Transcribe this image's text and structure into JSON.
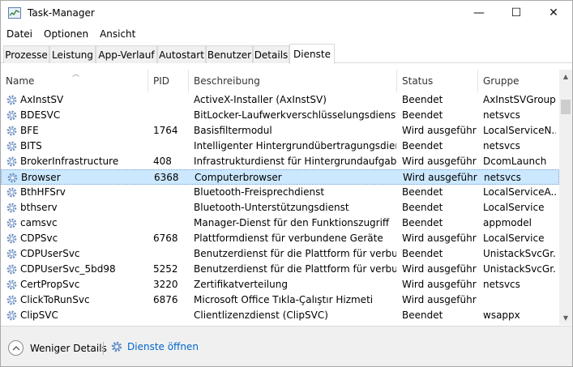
{
  "window": {
    "title": "Task-Manager",
    "minimize": "—",
    "maximize": "☐",
    "close": "✕"
  },
  "menu": [
    "Datei",
    "Optionen",
    "Ansicht"
  ],
  "tabs": [
    {
      "label": "Prozesse",
      "active": false
    },
    {
      "label": "Leistung",
      "active": false
    },
    {
      "label": "App-Verlauf",
      "active": false
    },
    {
      "label": "Autostart",
      "active": false
    },
    {
      "label": "Benutzer",
      "active": false
    },
    {
      "label": "Details",
      "active": false
    },
    {
      "label": "Dienste",
      "active": true
    }
  ],
  "columns": {
    "name": "Name",
    "pid": "PID",
    "desc": "Beschreibung",
    "status": "Status",
    "group": "Gruppe"
  },
  "rows": [
    {
      "name": "AxInstSV",
      "pid": "",
      "desc": "ActiveX-Installer (AxInstSV)",
      "status": "Beendet",
      "group": "AxInstSVGroup"
    },
    {
      "name": "BDESVC",
      "pid": "",
      "desc": "BitLocker-Laufwerkverschlüsselungsdienst",
      "status": "Beendet",
      "group": "netsvcs"
    },
    {
      "name": "BFE",
      "pid": "1764",
      "desc": "Basisfiltermodul",
      "status": "Wird ausgeführt",
      "group": "LocalServiceN..."
    },
    {
      "name": "BITS",
      "pid": "",
      "desc": "Intelligenter Hintergrundübertragungsdienst",
      "status": "Beendet",
      "group": "netsvcs"
    },
    {
      "name": "BrokerInfrastructure",
      "pid": "408",
      "desc": "Infrastrukturdienst für Hintergrundaufgaben",
      "status": "Wird ausgeführt",
      "group": "DcomLaunch"
    },
    {
      "name": "Browser",
      "pid": "6368",
      "desc": "Computerbrowser",
      "status": "Wird ausgeführt",
      "group": "netsvcs",
      "selected": true
    },
    {
      "name": "BthHFSrv",
      "pid": "",
      "desc": "Bluetooth-Freisprechdienst",
      "status": "Beendet",
      "group": "LocalServiceA..."
    },
    {
      "name": "bthserv",
      "pid": "",
      "desc": "Bluetooth-Unterstützungsdienst",
      "status": "Beendet",
      "group": "LocalService"
    },
    {
      "name": "camsvc",
      "pid": "",
      "desc": "Manager-Dienst für den Funktionszugriff",
      "status": "Beendet",
      "group": "appmodel"
    },
    {
      "name": "CDPSvc",
      "pid": "6768",
      "desc": "Plattformdienst für verbundene Geräte",
      "status": "Wird ausgeführt",
      "group": "LocalService"
    },
    {
      "name": "CDPUserSvc",
      "pid": "",
      "desc": "Benutzerdienst für die Plattform für verbund...",
      "status": "Beendet",
      "group": "UnistackSvcGr..."
    },
    {
      "name": "CDPUserSvc_5bd98",
      "pid": "5252",
      "desc": "Benutzerdienst für die Plattform für verbund...",
      "status": "Wird ausgeführt",
      "group": "UnistackSvcGr..."
    },
    {
      "name": "CertPropSvc",
      "pid": "3220",
      "desc": "Zertifikatverteilung",
      "status": "Wird ausgeführt",
      "group": "netsvcs"
    },
    {
      "name": "ClickToRunSvc",
      "pid": "6876",
      "desc": "Microsoft Office Tıkla-Çalıştır Hizmeti",
      "status": "Wird ausgeführt",
      "group": ""
    },
    {
      "name": "ClipSVC",
      "pid": "",
      "desc": "Clientlizenzdienst (ClipSVC)",
      "status": "Beendet",
      "group": "wsappx"
    }
  ],
  "footer": {
    "less_details": "Weniger Details",
    "open_services": "Dienste öffnen"
  }
}
